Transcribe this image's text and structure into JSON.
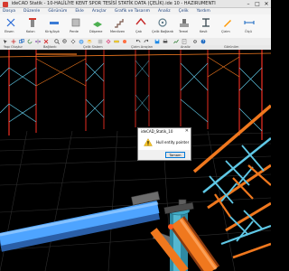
{
  "window": {
    "title": "ideCAD Statik - 10-HALİLİYE KENT SPOR TESİSİ STATİK DATA (ÇELİK).ide 10 - HAZIRUMENTI"
  },
  "menu": [
    "Dosya",
    "Düzenle",
    "Görünüm",
    "Ekle",
    "Araçlar",
    "Grafik ve Tasarım",
    "Analiz",
    "Çelik",
    "Yardım"
  ],
  "ribbon": {
    "labels": [
      "Eksen",
      "Kolon",
      "Kiriş/Aşık",
      "Perde",
      "Döşeme",
      "Merdiven",
      "Çatı",
      "Çelik Bağlantı",
      "Temel",
      "Kesit",
      "Çizim",
      "Ölçü"
    ]
  },
  "group_labels": [
    "Yapı Oluştur",
    "Bağlantı",
    "Çelik Sistem",
    "Çizim Araçları",
    "Analiz",
    "Görünüm"
  ],
  "dialog": {
    "title": "ideCAD_Statik_10",
    "message": "Hull entity pointer",
    "ok_label": "Tamam"
  },
  "colors": {
    "orange_member": "#f0781e",
    "cyan_member": "#5fc8e6",
    "red_member": "#d2281e",
    "blue_pipe": "#4ea4ff",
    "teal_pipe": "#3fa9c4",
    "grid": "#2c2c2c"
  }
}
